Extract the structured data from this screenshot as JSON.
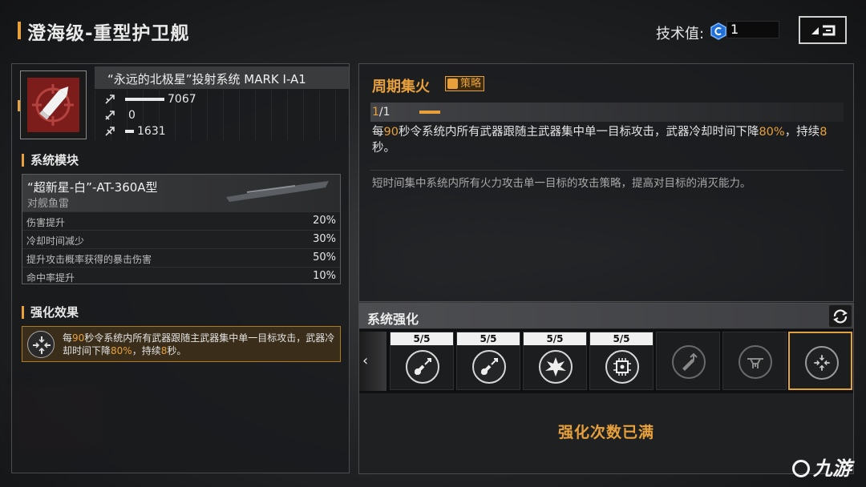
{
  "header": {
    "title": "澄海级-重型护卫舰",
    "tech_label": "技术值:",
    "tech_value": "1"
  },
  "weapon": {
    "name": "“永远的北极星”投射系统 MARK I-A1",
    "stats": [
      {
        "icon": "damage-icon",
        "value": "7067",
        "fill": 0.7
      },
      {
        "icon": "fire-rate-icon",
        "value": "0",
        "fill": 0.0
      },
      {
        "icon": "range-icon",
        "value": "1631",
        "fill": 0.15
      }
    ]
  },
  "system_module": {
    "section_title": "系统模块",
    "name": "“超新星-白”-AT-360A型",
    "type": "对舰鱼雷",
    "rows": [
      {
        "label": "伤害提升",
        "value": "20%"
      },
      {
        "label": "冷却时间减少",
        "value": "30%"
      },
      {
        "label": "提升攻击概率获得的暴击伤害",
        "value": "50%"
      },
      {
        "label": "命中率提升",
        "value": "10%"
      }
    ]
  },
  "enhance_effect": {
    "section_title": "强化效果",
    "text_parts": [
      "每",
      "90",
      "秒令系统内所有武器跟随主武器集中单一目标攻击，武器冷却时间下降",
      "80%",
      "，持续",
      "8",
      "秒。"
    ]
  },
  "tactic": {
    "title": "周期集火",
    "badge": "策略",
    "level_current": "1",
    "level_sep": "/1",
    "desc_parts": [
      "每",
      "90",
      "秒令系统内所有武器跟随主武器集中单一目标攻击，武器冷却时间下降",
      "80%",
      "，持续",
      "8",
      "秒。"
    ],
    "flavor": "短时间集中系统内所有火力攻击单一目标的攻击策略，提高对目标的消灭能力。"
  },
  "system_enhance": {
    "title": "系统强化",
    "slots": [
      {
        "count": "5/5",
        "icon": "guitar-arrow-icon"
      },
      {
        "count": "5/5",
        "icon": "guitar-arrow-icon"
      },
      {
        "count": "5/5",
        "icon": "explosion-icon"
      },
      {
        "count": "5/5",
        "icon": "signal-chip-icon"
      },
      {
        "count": "",
        "icon": "upgrade-pen-icon"
      },
      {
        "count": "",
        "icon": "drone-icon"
      },
      {
        "count": "",
        "icon": "focus-fire-icon"
      }
    ],
    "status": "强化次数已满"
  },
  "watermark": "九游",
  "colors": {
    "accent": "#e8a13a",
    "weapon_icon_bg": "#7c1d1b"
  }
}
